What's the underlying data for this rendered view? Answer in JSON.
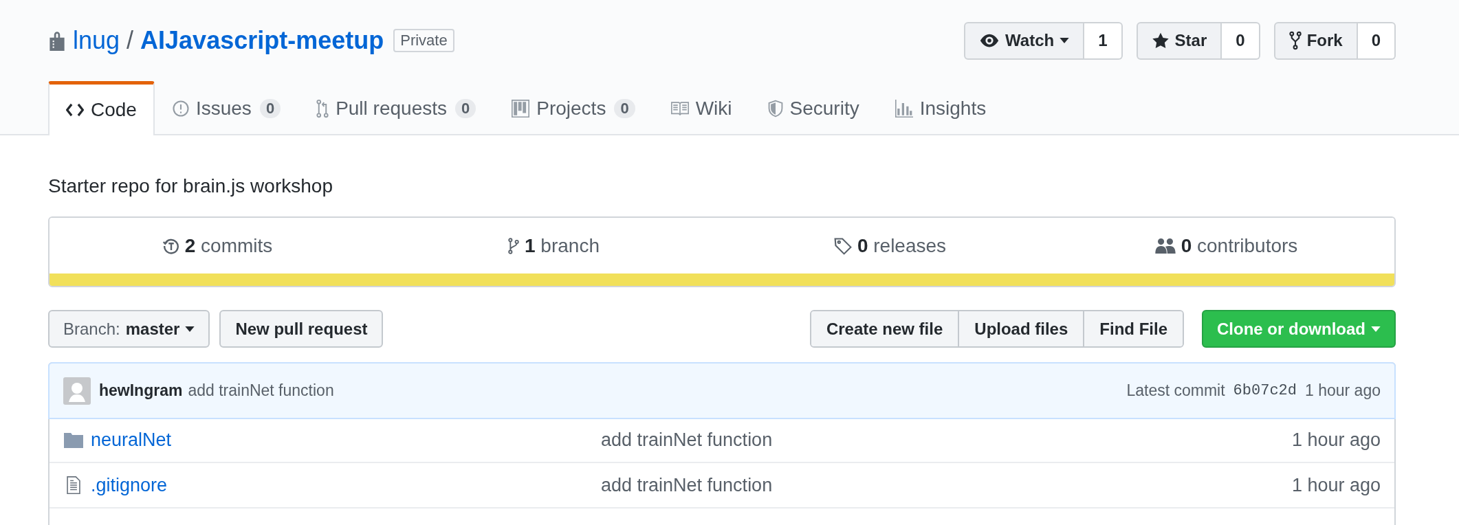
{
  "repo": {
    "owner": "lnug",
    "separator": "/",
    "name": "AIJavascript-meetup",
    "visibility": "Private"
  },
  "actions": [
    {
      "kind": "watch",
      "label": "Watch",
      "count": "1",
      "dropdown": true
    },
    {
      "kind": "star",
      "label": "Star",
      "count": "0",
      "dropdown": false
    },
    {
      "kind": "fork",
      "label": "Fork",
      "count": "0",
      "dropdown": false
    }
  ],
  "tabs": [
    {
      "kind": "code",
      "label": "Code",
      "selected": true
    },
    {
      "kind": "issues",
      "label": "Issues",
      "count": "0",
      "selected": false
    },
    {
      "kind": "pulls",
      "label": "Pull requests",
      "count": "0",
      "selected": false
    },
    {
      "kind": "projects",
      "label": "Projects",
      "count": "0",
      "selected": false
    },
    {
      "kind": "wiki",
      "label": "Wiki",
      "selected": false
    },
    {
      "kind": "security",
      "label": "Security",
      "selected": false
    },
    {
      "kind": "insights",
      "label": "Insights",
      "selected": false
    }
  ],
  "description": "Starter repo for brain.js workshop",
  "summary": [
    {
      "kind": "commits",
      "number": "2",
      "label": "commits"
    },
    {
      "kind": "branches",
      "number": "1",
      "label": "branch"
    },
    {
      "kind": "releases",
      "number": "0",
      "label": "releases"
    },
    {
      "kind": "contributors",
      "number": "0",
      "label": "contributors"
    }
  ],
  "branch_select": {
    "prefix": "Branch:",
    "value": "master"
  },
  "new_pull_request": "New pull request",
  "file_buttons": [
    "Create new file",
    "Upload files",
    "Find File"
  ],
  "clone_button": "Clone or download",
  "latest_commit": {
    "author": "hewIngram",
    "message": "add trainNet function",
    "prefix": "Latest commit",
    "sha": "6b07c2d",
    "time": "1 hour ago"
  },
  "files": [
    {
      "kind": "folder",
      "name": "neuralNet",
      "message": "add trainNet function",
      "age": "1 hour ago"
    },
    {
      "kind": "file",
      "name": ".gitignore",
      "message": "add trainNet function",
      "age": "1 hour ago"
    }
  ]
}
